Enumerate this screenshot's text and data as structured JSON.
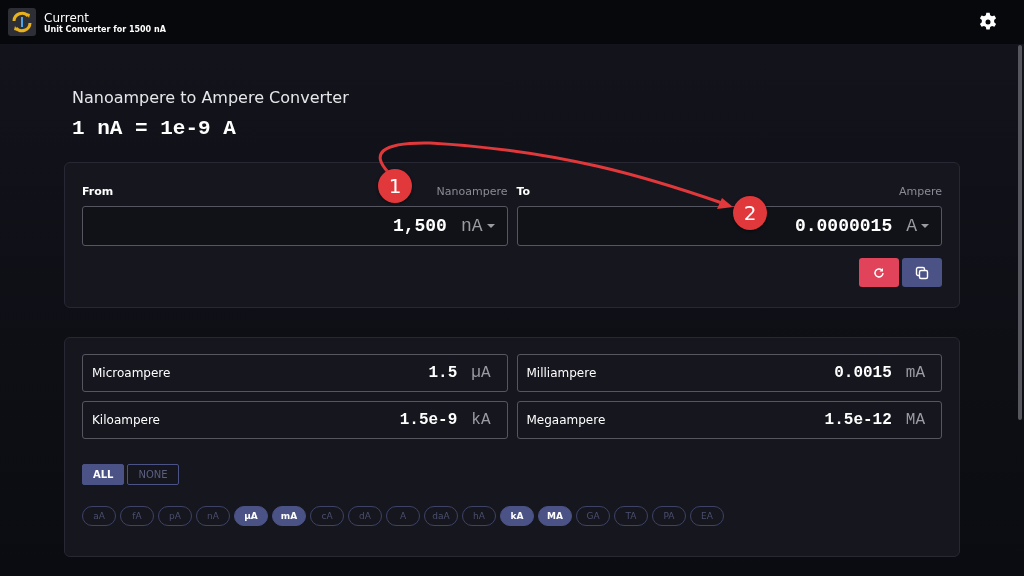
{
  "app": {
    "title": "Current",
    "subtitle": "Unit Converter for 1500 nA"
  },
  "converter": {
    "title": "Nanoampere to Ampere Converter",
    "formula": "1 nA = 1e-9 A",
    "from": {
      "label": "From",
      "unit_name": "Nanoampere",
      "value": "1,500",
      "unit": "nA"
    },
    "to": {
      "label": "To",
      "unit_name": "Ampere",
      "value": "0.0000015",
      "unit": "A"
    }
  },
  "results": [
    {
      "name": "Microampere",
      "value": "1.5",
      "unit": "µA"
    },
    {
      "name": "Milliampere",
      "value": "0.0015",
      "unit": "mA"
    },
    {
      "name": "Kiloampere",
      "value": "1.5e-9",
      "unit": "kA"
    },
    {
      "name": "Megaampere",
      "value": "1.5e-12",
      "unit": "MA"
    }
  ],
  "filter_buttons": [
    {
      "label": "ALL",
      "selected": true
    },
    {
      "label": "NONE",
      "selected": false
    }
  ],
  "unit_chips": [
    {
      "label": "aA",
      "selected": false
    },
    {
      "label": "fA",
      "selected": false
    },
    {
      "label": "pA",
      "selected": false
    },
    {
      "label": "nA",
      "selected": false
    },
    {
      "label": "µA",
      "selected": true
    },
    {
      "label": "mA",
      "selected": true
    },
    {
      "label": "cA",
      "selected": false
    },
    {
      "label": "dA",
      "selected": false
    },
    {
      "label": "A",
      "selected": false
    },
    {
      "label": "daA",
      "selected": false
    },
    {
      "label": "hA",
      "selected": false
    },
    {
      "label": "kA",
      "selected": true
    },
    {
      "label": "MA",
      "selected": true
    },
    {
      "label": "GA",
      "selected": false
    },
    {
      "label": "TA",
      "selected": false
    },
    {
      "label": "PA",
      "selected": false
    },
    {
      "label": "EA",
      "selected": false
    }
  ],
  "annotations": [
    {
      "label": "1"
    },
    {
      "label": "2"
    }
  ]
}
